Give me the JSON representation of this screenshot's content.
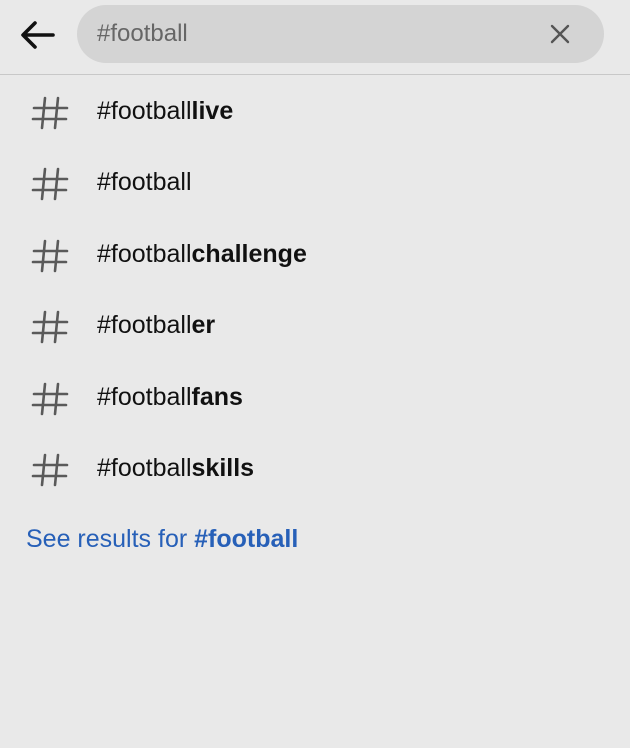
{
  "header": {
    "back_icon": "arrow-left-icon",
    "search": {
      "value": "#football",
      "placeholder": ""
    },
    "clear_icon": "close-icon"
  },
  "suggestions": [
    {
      "icon": "hashtag-icon",
      "prefix": "#football",
      "completion": "live"
    },
    {
      "icon": "hashtag-icon",
      "prefix": "#football",
      "completion": ""
    },
    {
      "icon": "hashtag-icon",
      "prefix": "#football",
      "completion": "challenge"
    },
    {
      "icon": "hashtag-icon",
      "prefix": "#football",
      "completion": "er"
    },
    {
      "icon": "hashtag-icon",
      "prefix": "#football",
      "completion": "fans"
    },
    {
      "icon": "hashtag-icon",
      "prefix": "#football",
      "completion": "skills"
    }
  ],
  "see_results": {
    "label": "See results for ",
    "query": "#football"
  },
  "colors": {
    "background": "#e9e9e9",
    "search_box": "#d4d4d4",
    "link": "#2760b8",
    "text": "#111111",
    "icon": "#5a5a5a"
  }
}
